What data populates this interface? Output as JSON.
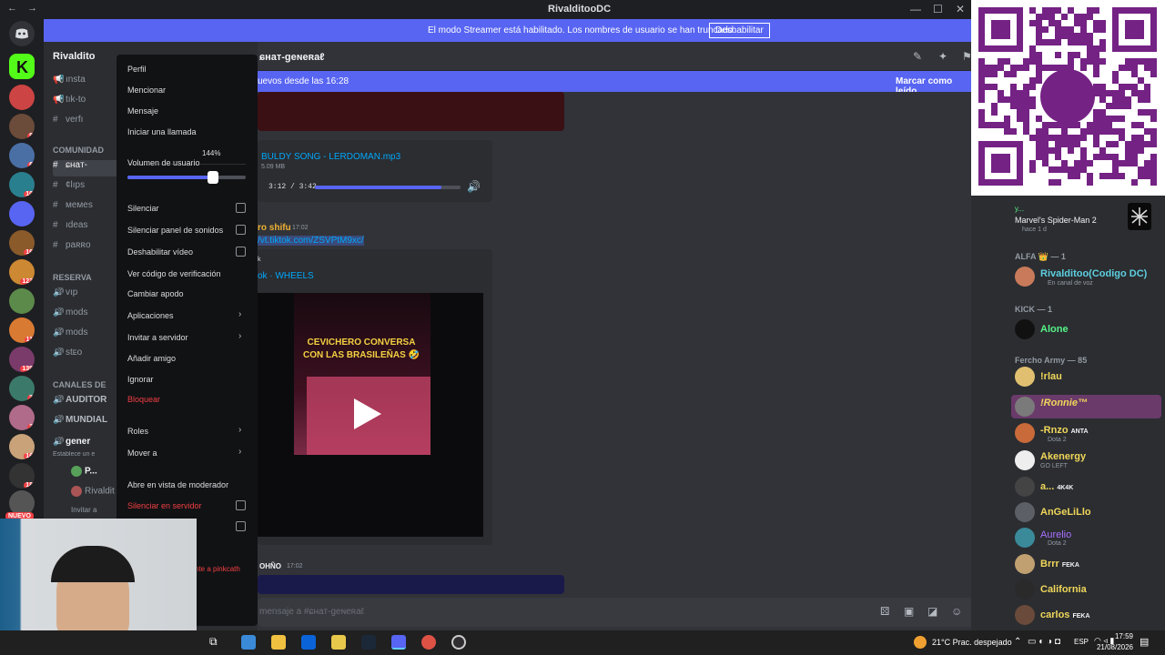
{
  "titlebar": {
    "nav": "←  →",
    "title": "RivalditooDC",
    "min": "—",
    "max": "☐",
    "close": "✕"
  },
  "banner": {
    "text": "El modo Streamer está habilitado. Los nombres de usuario se han truncado.",
    "button": "Deshabilitar"
  },
  "server": {
    "name": "Rivaldito"
  },
  "sidebar": {
    "channels": [
      {
        "icon": "📢",
        "label": "ınsta"
      },
      {
        "icon": "📢",
        "label": "tık-to"
      },
      {
        "icon": "#",
        "label": "verfı"
      },
      {
        "icon": "#",
        "label": "ɕнaт-"
      },
      {
        "icon": "#",
        "label": "¢lıps"
      },
      {
        "icon": "#",
        "label": "мeмes"
      },
      {
        "icon": "#",
        "label": "ıdeas"
      },
      {
        "icon": "#",
        "label": "paʀʀo"
      },
      {
        "icon": "🔊",
        "label": "vıp"
      },
      {
        "icon": "🔊",
        "label": "mods"
      },
      {
        "icon": "🔊",
        "label": "mods"
      },
      {
        "icon": "🔊",
        "label": "stᴇᴏ"
      },
      {
        "icon": "🔊",
        "label": "AUDITOR"
      },
      {
        "icon": "🔊",
        "label": "MUNDIAL"
      },
      {
        "icon": "🔊",
        "label": "gener"
      }
    ],
    "categories": {
      "comunidad": "COMUNIDAD",
      "reserva": "RESERVA",
      "canales": "CANALES DE"
    },
    "voice_note": "Establece un e",
    "voice_users": [
      "P...",
      "Rivaldit"
    ],
    "invite": "Invitar a"
  },
  "chat": {
    "channel": "ɕнaт-geɴeʀaℓ",
    "new_messages": "uevos desde las 16:28",
    "mark_read": "Marcar como leído",
    "audio": {
      "name": "BULDY SONG - LERDOMAN.mp3",
      "size": "5.09 MB",
      "time": "3:12 / 3:42",
      "progress": 0.87
    },
    "msg_author": "ro shifu",
    "msg_time": "17:02",
    "msg_link": "/vt.tiktok.com/ZSVPtM9xc/",
    "embed_k": "k",
    "embed_title": "ok · WHEELS",
    "video_caption": "CEVICHERO CONVERSA CON LAS BRASILEÑAS 🤣",
    "msg2_author": "OHÑO",
    "msg2_time": "17:02",
    "pinkcath": "nte a pinkcath",
    "composer_placeholder": "mensaje a #ɕнaт-geɴeʀaℓ"
  },
  "menu": {
    "items": [
      {
        "label": "Perfil"
      },
      {
        "label": "Mencionar"
      },
      {
        "label": "Mensaje"
      },
      {
        "label": "Iniciar una llamada"
      }
    ],
    "volume_label": "Volumen de usuario",
    "volume_value": "144%",
    "volume_fraction": 0.72,
    "toggles": [
      "Silenciar",
      "Silenciar panel de sonidos",
      "Deshabilitar vídeo"
    ],
    "items2": [
      "Ver código de verificación",
      "Cambiar apodo"
    ],
    "submenus": [
      "Aplicaciones",
      "Invitar a servidor"
    ],
    "items3": [
      "Añadir amigo",
      "Ignorar"
    ],
    "block": "Bloquear",
    "submenus2": [
      "Roles",
      "Mover a"
    ],
    "mod_view": "Abre en vista de moderador",
    "server_mute": "Silenciar en servidor",
    "server_mute2": "r"
  },
  "members": {
    "activity": {
      "user": "y...",
      "game": "Marvel's Spider-Man 2",
      "ago": "hace 1 d"
    },
    "groups": [
      {
        "title": "ALFA 👑 — 1"
      },
      {
        "title": "KICK — 1"
      },
      {
        "title": "Fercho Army — 85"
      }
    ],
    "list": [
      {
        "name": "Rivalditoo(Codigo DC)",
        "sub": "En canal de voz",
        "color": "#5dcfe0"
      },
      {
        "name": "Alone",
        "sub": "",
        "color": "#57f287"
      },
      {
        "name": "!rlau",
        "sub": "",
        "color": "#f0d75a"
      },
      {
        "name": "!Ronnie™",
        "sub": "",
        "color": "#f0d75a"
      },
      {
        "name": "-Rnzo",
        "sub": "Dota 2",
        "color": "#f0d75a",
        "badge": "ANTA"
      },
      {
        "name": "Akenergy",
        "sub": "GO LEFT",
        "color": "#f0d75a"
      },
      {
        "name": "a...",
        "sub": "",
        "color": "#f0d75a",
        "badge": "4K4K"
      },
      {
        "name": "AnGeLiLlo",
        "sub": "",
        "color": "#f0d75a"
      },
      {
        "name": "Aurelio",
        "sub": "Dota 2",
        "color": "#a970ff"
      },
      {
        "name": "Brrr",
        "sub": "",
        "color": "#f0d75a",
        "badge": "FEKA"
      },
      {
        "name": "California",
        "sub": "",
        "color": "#f0d75a"
      },
      {
        "name": "carlos",
        "sub": "",
        "color": "#f0d75a",
        "badge": "FEKA"
      }
    ]
  },
  "taskbar": {
    "weather": "21°C  Prac. despejado",
    "lang": "ESP",
    "time": "17:59",
    "date": "21/08/2026"
  },
  "colors": {
    "accent": "#5865f2",
    "bg": "#313338",
    "danger": "#f23f43",
    "yape": "#742284"
  }
}
